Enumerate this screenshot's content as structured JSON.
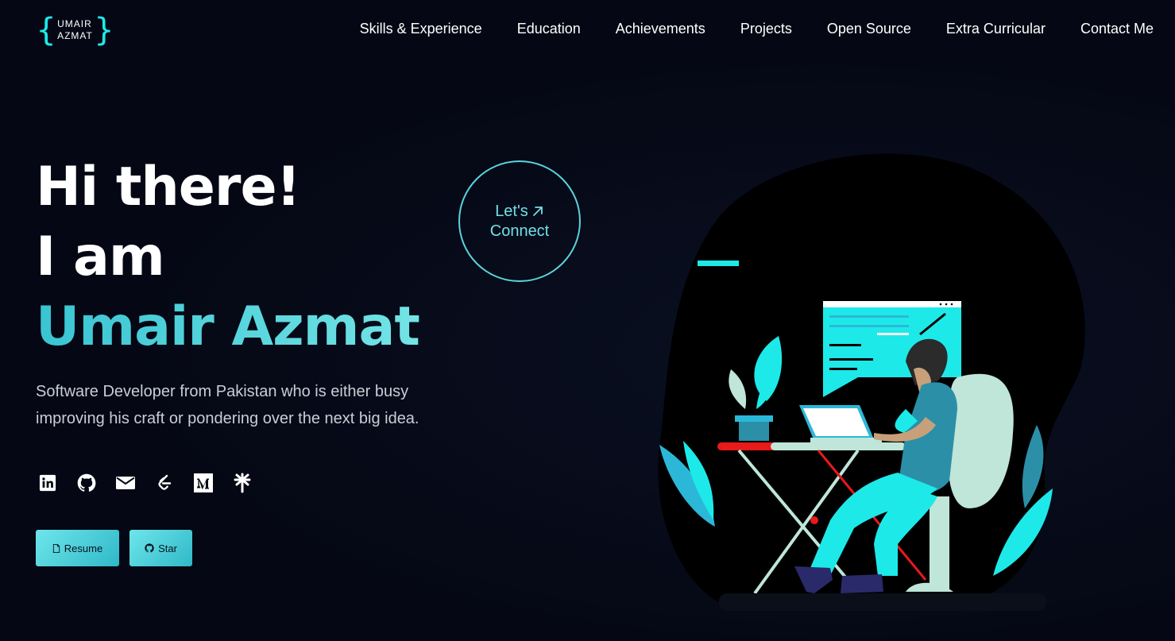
{
  "logo": {
    "line1": "UMAIR",
    "line2": "AZMAT",
    "brace_left": "{",
    "brace_right": "}"
  },
  "nav": {
    "items": [
      {
        "label": "Skills & Experience"
      },
      {
        "label": "Education"
      },
      {
        "label": "Achievements"
      },
      {
        "label": "Projects"
      },
      {
        "label": "Open Source"
      },
      {
        "label": "Extra Curricular"
      },
      {
        "label": "Contact Me"
      }
    ]
  },
  "hero": {
    "line1": "Hi there!",
    "line2": "I am",
    "name": "Umair Azmat",
    "description": "Software Developer from Pakistan who is either busy improving his craft or pondering over the next big idea."
  },
  "connect": {
    "line1": "Let's",
    "line2": "Connect"
  },
  "socials": [
    {
      "icon": "linkedin-icon"
    },
    {
      "icon": "github-icon"
    },
    {
      "icon": "mail-icon"
    },
    {
      "icon": "leetcode-icon"
    },
    {
      "icon": "medium-icon"
    },
    {
      "icon": "linktree-icon"
    }
  ],
  "buttons": {
    "resume_label": "Resume",
    "star_label": "Star"
  },
  "colors": {
    "background": "#050814",
    "accent": "#1de9e9",
    "accent_soft": "#6fe0e6",
    "text": "#ffffff",
    "muted": "#c9cdd6"
  }
}
